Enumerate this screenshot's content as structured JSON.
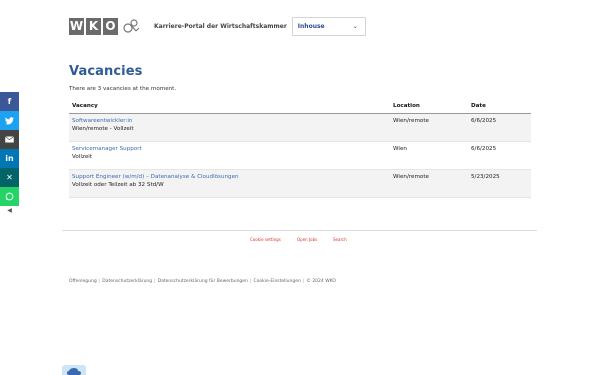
{
  "header": {
    "logo_letters": [
      "W",
      "K",
      "O"
    ],
    "portal_title": "Karriere-Portal der Wirtschaftskammer",
    "select_value": "Inhouse"
  },
  "main": {
    "title": "Vacancies",
    "count_text": "There are 3 vacancies at the moment."
  },
  "table": {
    "headers": {
      "vacancy": "Vacancy",
      "location": "Location",
      "date": "Date"
    },
    "rows": [
      {
        "title": "Softwareentwickler:in",
        "subtitle": "Wien/remote - Vollzeit",
        "location": "Wien/remote",
        "date": "6/6/2025"
      },
      {
        "title": "Servicemanager Support",
        "subtitle": "Vollzeit",
        "location": "Wien",
        "date": "6/6/2025"
      },
      {
        "title": "Support Engineer (w/m/d) – Datenanalyse & Cloudlösungen",
        "subtitle": "Vollzeit oder Teilzeit ab 32 Std/W",
        "location": "Wien/remote",
        "date": "5/23/2025"
      }
    ]
  },
  "footer": {
    "links": [
      "Cookie settings",
      "Open Jobs",
      "Search"
    ],
    "legal": [
      "Offenlegung",
      "Datenschutzerklärung",
      "Datenschutzerklärung für Bewerbungen",
      "Cookie-Einstellungen",
      "© 2024 WKO"
    ]
  },
  "social": [
    {
      "name": "facebook",
      "glyph": "f",
      "color": "#3b5998"
    },
    {
      "name": "twitter",
      "glyph": "t",
      "color": "#1da1f2"
    },
    {
      "name": "email",
      "glyph": "✉",
      "color": "#444444"
    },
    {
      "name": "linkedin",
      "glyph": "in",
      "color": "#0077b5"
    },
    {
      "name": "xing",
      "glyph": "x",
      "color": "#026466"
    },
    {
      "name": "whatsapp",
      "glyph": "w",
      "color": "#25d366"
    }
  ],
  "colors": {
    "accent": "#2f5b96",
    "link": "#3a6ab0",
    "footer_link": "#d9342b"
  }
}
